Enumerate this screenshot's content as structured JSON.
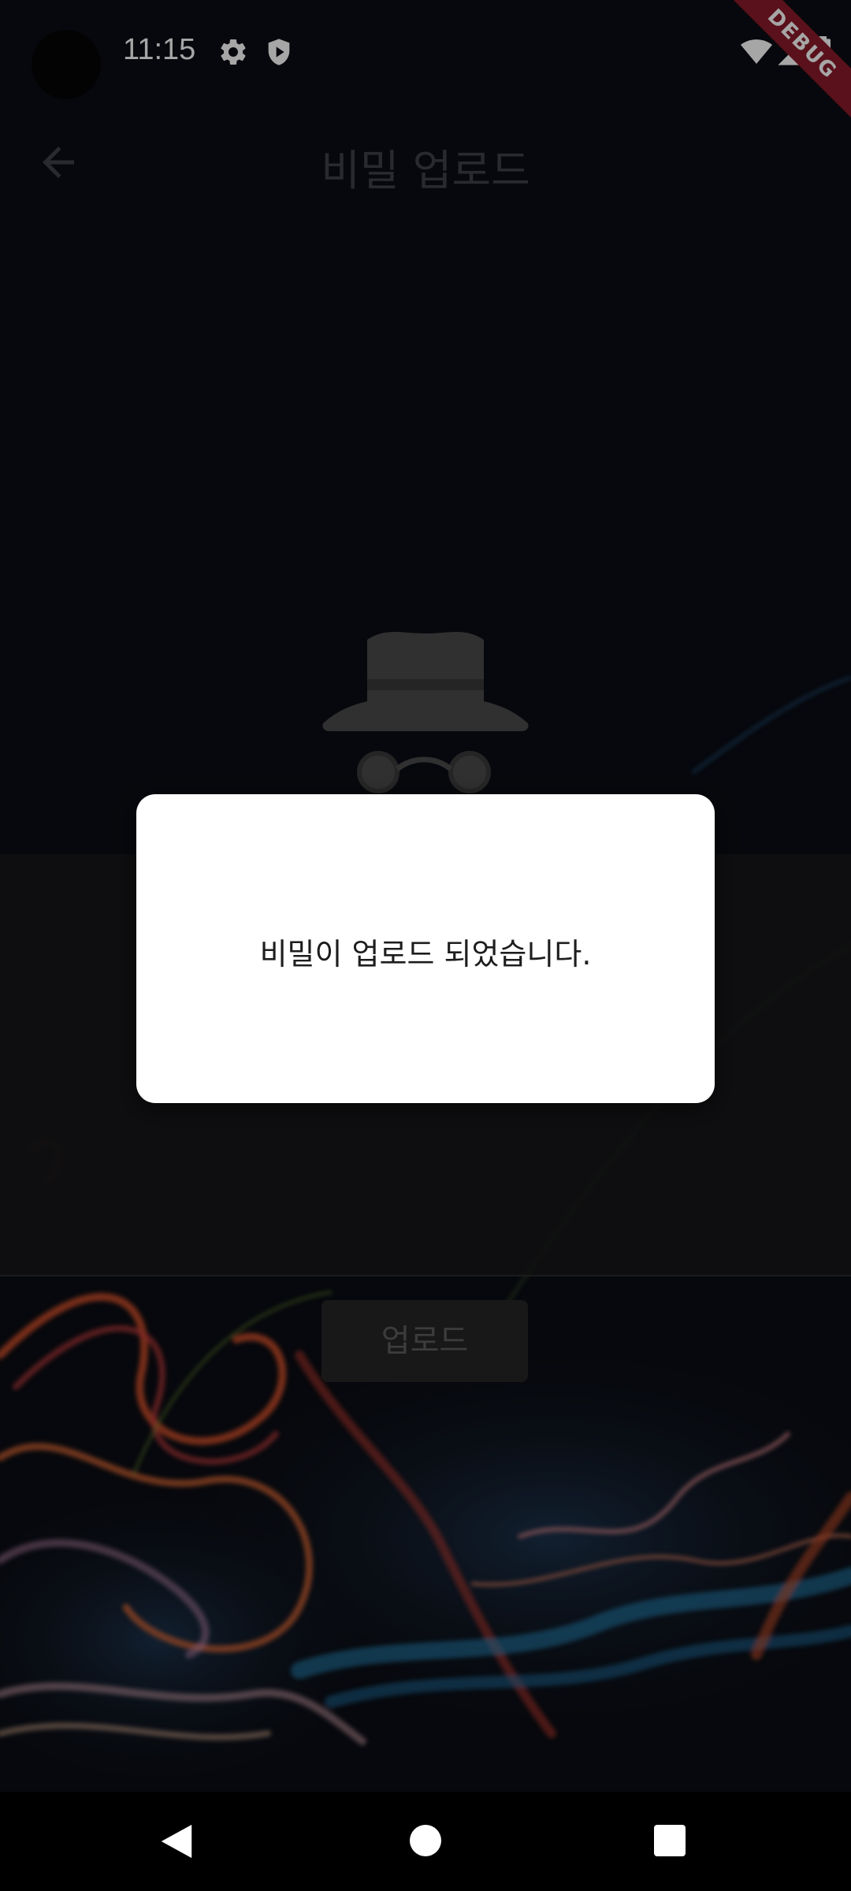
{
  "status_bar": {
    "time": "11:15",
    "icons": [
      "gear-icon",
      "shield-play-icon",
      "wifi-icon",
      "signal-icon",
      "battery-icon"
    ],
    "debug_banner": "DEBUG"
  },
  "app_bar": {
    "back_icon": "arrow-left-icon",
    "title": "비밀 업로드"
  },
  "main": {
    "hero_icon": "incognito-spy-icon",
    "upload_button_label": "업로드"
  },
  "dialog": {
    "message": "비밀이 업로드 되었습니다."
  },
  "nav_bar": {
    "buttons": [
      "back-triangle-icon",
      "home-circle-icon",
      "recents-square-icon"
    ]
  },
  "colors": {
    "background": "#0b0d14",
    "dialog_bg": "#ffffff",
    "debug_banner": "#8b1b2a"
  }
}
